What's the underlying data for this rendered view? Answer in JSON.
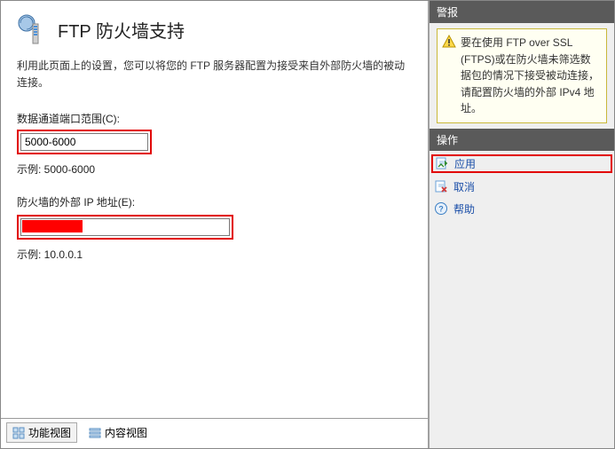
{
  "header": {
    "title": "FTP 防火墙支持"
  },
  "main": {
    "description": "利用此页面上的设置，您可以将您的 FTP 服务器配置为接受来自外部防火墙的被动连接。",
    "portRange": {
      "label": "数据通道端口范围(C):",
      "value": "5000-6000",
      "example": "示例: 5000-6000"
    },
    "externalIp": {
      "label": "防火墙的外部 IP 地址(E):",
      "value": "",
      "example": "示例: 10.0.0.1"
    }
  },
  "tabs": {
    "features": "功能视图",
    "content": "内容视图"
  },
  "side": {
    "alertsHeader": "警报",
    "alertText": "要在使用 FTP over SSL (FTPS)或在防火墙未筛选数据包的情况下接受被动连接，请配置防火墙的外部 IPv4 地址。",
    "actionsHeader": "操作",
    "apply": "应用",
    "cancel": "取消",
    "help": "帮助"
  }
}
